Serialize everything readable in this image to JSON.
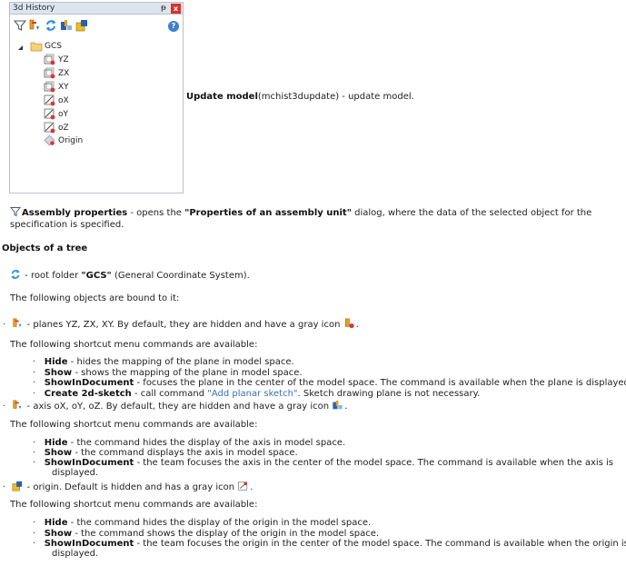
{
  "panel": {
    "title": "3d History",
    "pin_glyph": "ᵽ",
    "close_glyph": "x",
    "help_glyph": "?",
    "toolbar_icons": [
      "assembly-properties-icon",
      "plane-icon",
      "refresh-icon",
      "axis-icon",
      "origin-icon"
    ],
    "tree": {
      "root": "GCS",
      "items": [
        "YZ",
        "ZX",
        "XY",
        "oX",
        "oY",
        "oZ",
        "Origin"
      ]
    }
  },
  "update_model": {
    "name": "Update model",
    "command": "(mchist3dupdate)",
    "desc": " - update model."
  },
  "assembly": {
    "name": "Assembly properties",
    "text1": " - opens the ",
    "dialog": "\"Properties of an assembly unit\"",
    "text2": " dialog, where the data of the selected object for the",
    "line2": "specification is specified."
  },
  "objects_heading": "Objects of a tree",
  "root_folder": {
    "pre": " - root folder ",
    "name": "\"GCS\"",
    "post": " (General Coordinate System)."
  },
  "bound_text": "The following objects are bound to it:",
  "planes": {
    "text": " - planes YZ, ZX, XY. By default, they are hidden and have a gray icon",
    "end": ".",
    "menu_intro": "The following shortcut menu commands are available:",
    "commands": [
      {
        "name": "Hide",
        "desc": " - hides the mapping of the plane in model space."
      },
      {
        "name": "Show",
        "desc": " - shows the mapping of the plane in model space."
      },
      {
        "name": "ShowInDocument",
        "desc": " - focuses the plane in the center of the model space. The command is available when the plane is displayed."
      },
      {
        "name": "Create 2d-sketch",
        "desc": " - call command ",
        "link": "\"Add planar sketch\"",
        "desc2": ". Sketch drawing plane is not necessary."
      }
    ]
  },
  "axis": {
    "text": " - axis oX, oY, oZ. By default, they are hidden and have a gray icon",
    "end": ".",
    "menu_intro": "The following shortcut menu commands are available:",
    "commands": [
      {
        "name": "Hide",
        "desc": " - the command hides the display of the axis in model space."
      },
      {
        "name": "Show",
        "desc": " - the command displays the axis in model space."
      },
      {
        "name": "ShowInDocument",
        "desc": " - the team focuses the axis in the center of the model space. The command is available when the axis is",
        "cont": "displayed."
      }
    ]
  },
  "origin": {
    "text": " - origin. Default is hidden and has a gray icon",
    "end": ".",
    "menu_intro": "The following shortcut menu commands are available:",
    "commands": [
      {
        "name": "Hide",
        "desc": " - the command hides the display of the origin in the model space."
      },
      {
        "name": "Show",
        "desc": " - the command shows the display of the origin in the model space."
      },
      {
        "name": "ShowInDocument",
        "desc": " - the team focuses the origin in the center of the model space. The command is available when the origin is",
        "cont": "displayed."
      }
    ]
  },
  "bullet": "·",
  "colors": {
    "accent": "#3a6fb5",
    "panel_title_bg": "#dde4ee",
    "close_bg": "#d8332b"
  }
}
